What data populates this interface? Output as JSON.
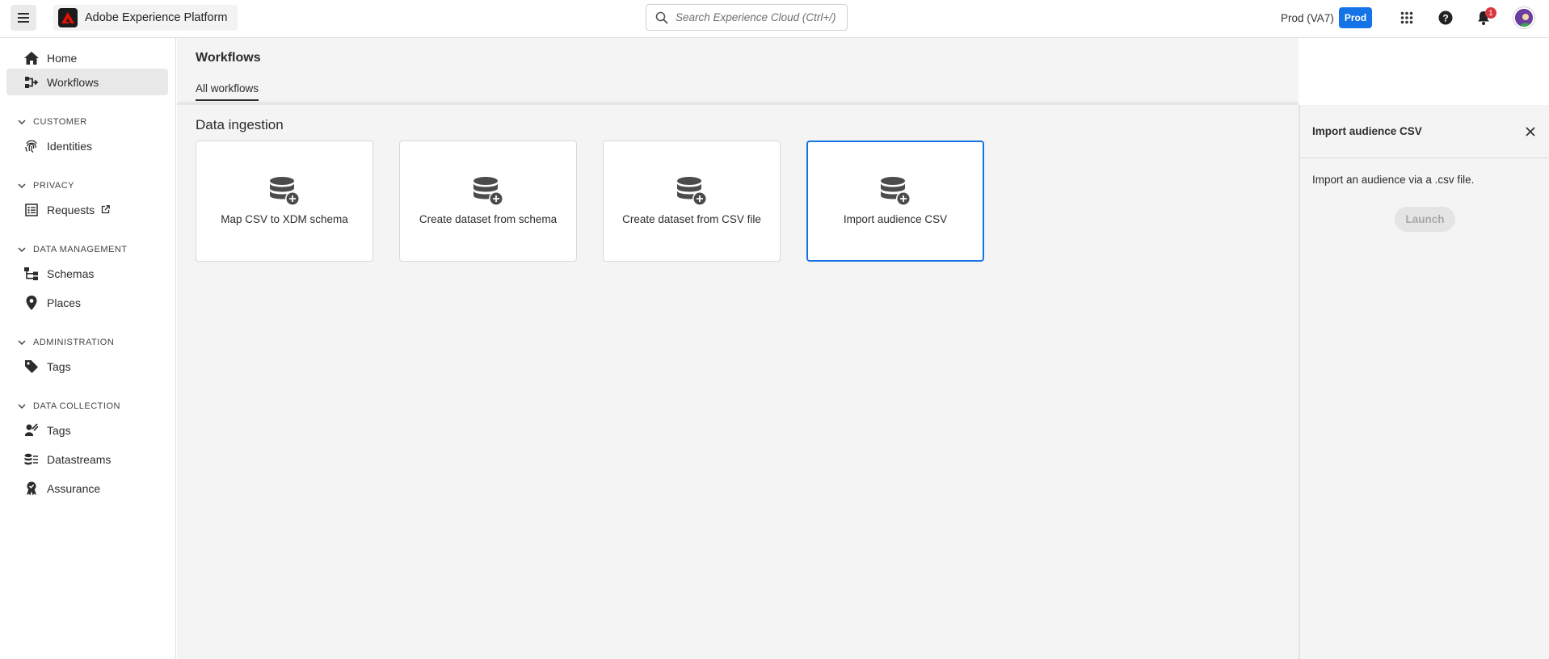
{
  "app": {
    "title": "Adobe Experience Platform",
    "logo_icon": "adobe-logo-icon",
    "menu_icon": "hamburger-menu-icon"
  },
  "search": {
    "placeholder": "Search Experience Cloud (Ctrl+/)",
    "icon": "search-icon"
  },
  "header": {
    "org_label": "Prod (VA7)",
    "env_badge": "Prod",
    "apps_icon": "apps-grid-icon",
    "help_icon": "help-icon",
    "notifications_icon": "bell-icon",
    "notification_count": "1",
    "avatar": "user-avatar"
  },
  "sidebar": {
    "items_top": [
      {
        "label": "Home",
        "icon": "home-icon"
      },
      {
        "label": "Workflows",
        "icon": "workflow-icon",
        "active": true
      }
    ],
    "sections": [
      {
        "heading": "CUSTOMER",
        "items": [
          {
            "label": "Identities",
            "icon": "fingerprint-icon"
          }
        ]
      },
      {
        "heading": "PRIVACY",
        "items": [
          {
            "label": "Requests",
            "icon": "request-list-icon",
            "external_icon": "external-link-icon"
          }
        ]
      },
      {
        "heading": "DATA MANAGEMENT",
        "items": [
          {
            "label": "Schemas",
            "icon": "schema-icon"
          },
          {
            "label": "Places",
            "icon": "location-pin-icon"
          }
        ]
      },
      {
        "heading": "ADMINISTRATION",
        "items": [
          {
            "label": "Tags",
            "icon": "tag-icon"
          }
        ]
      },
      {
        "heading": "DATA COLLECTION",
        "items": [
          {
            "label": "Tags",
            "icon": "tags-collection-icon"
          },
          {
            "label": "Datastreams",
            "icon": "datastream-icon"
          },
          {
            "label": "Assurance",
            "icon": "assurance-icon"
          }
        ]
      }
    ]
  },
  "main": {
    "title": "Workflows",
    "tab": "All workflows",
    "section_title": "Data ingestion",
    "cards": [
      {
        "label": "Map CSV to XDM schema",
        "icon": "database-add-icon"
      },
      {
        "label": "Create dataset from schema",
        "icon": "database-add-icon"
      },
      {
        "label": "Create dataset from CSV file",
        "icon": "database-add-icon"
      },
      {
        "label": "Import audience CSV",
        "icon": "database-add-icon",
        "selected": true
      }
    ]
  },
  "panel": {
    "title": "Import audience CSV",
    "description": "Import an audience via a .csv file.",
    "launch_label": "Launch",
    "close_icon": "close-icon"
  },
  "colors": {
    "accent": "#1473e6",
    "notification": "#d7373f",
    "background": "#f4f4f4"
  }
}
